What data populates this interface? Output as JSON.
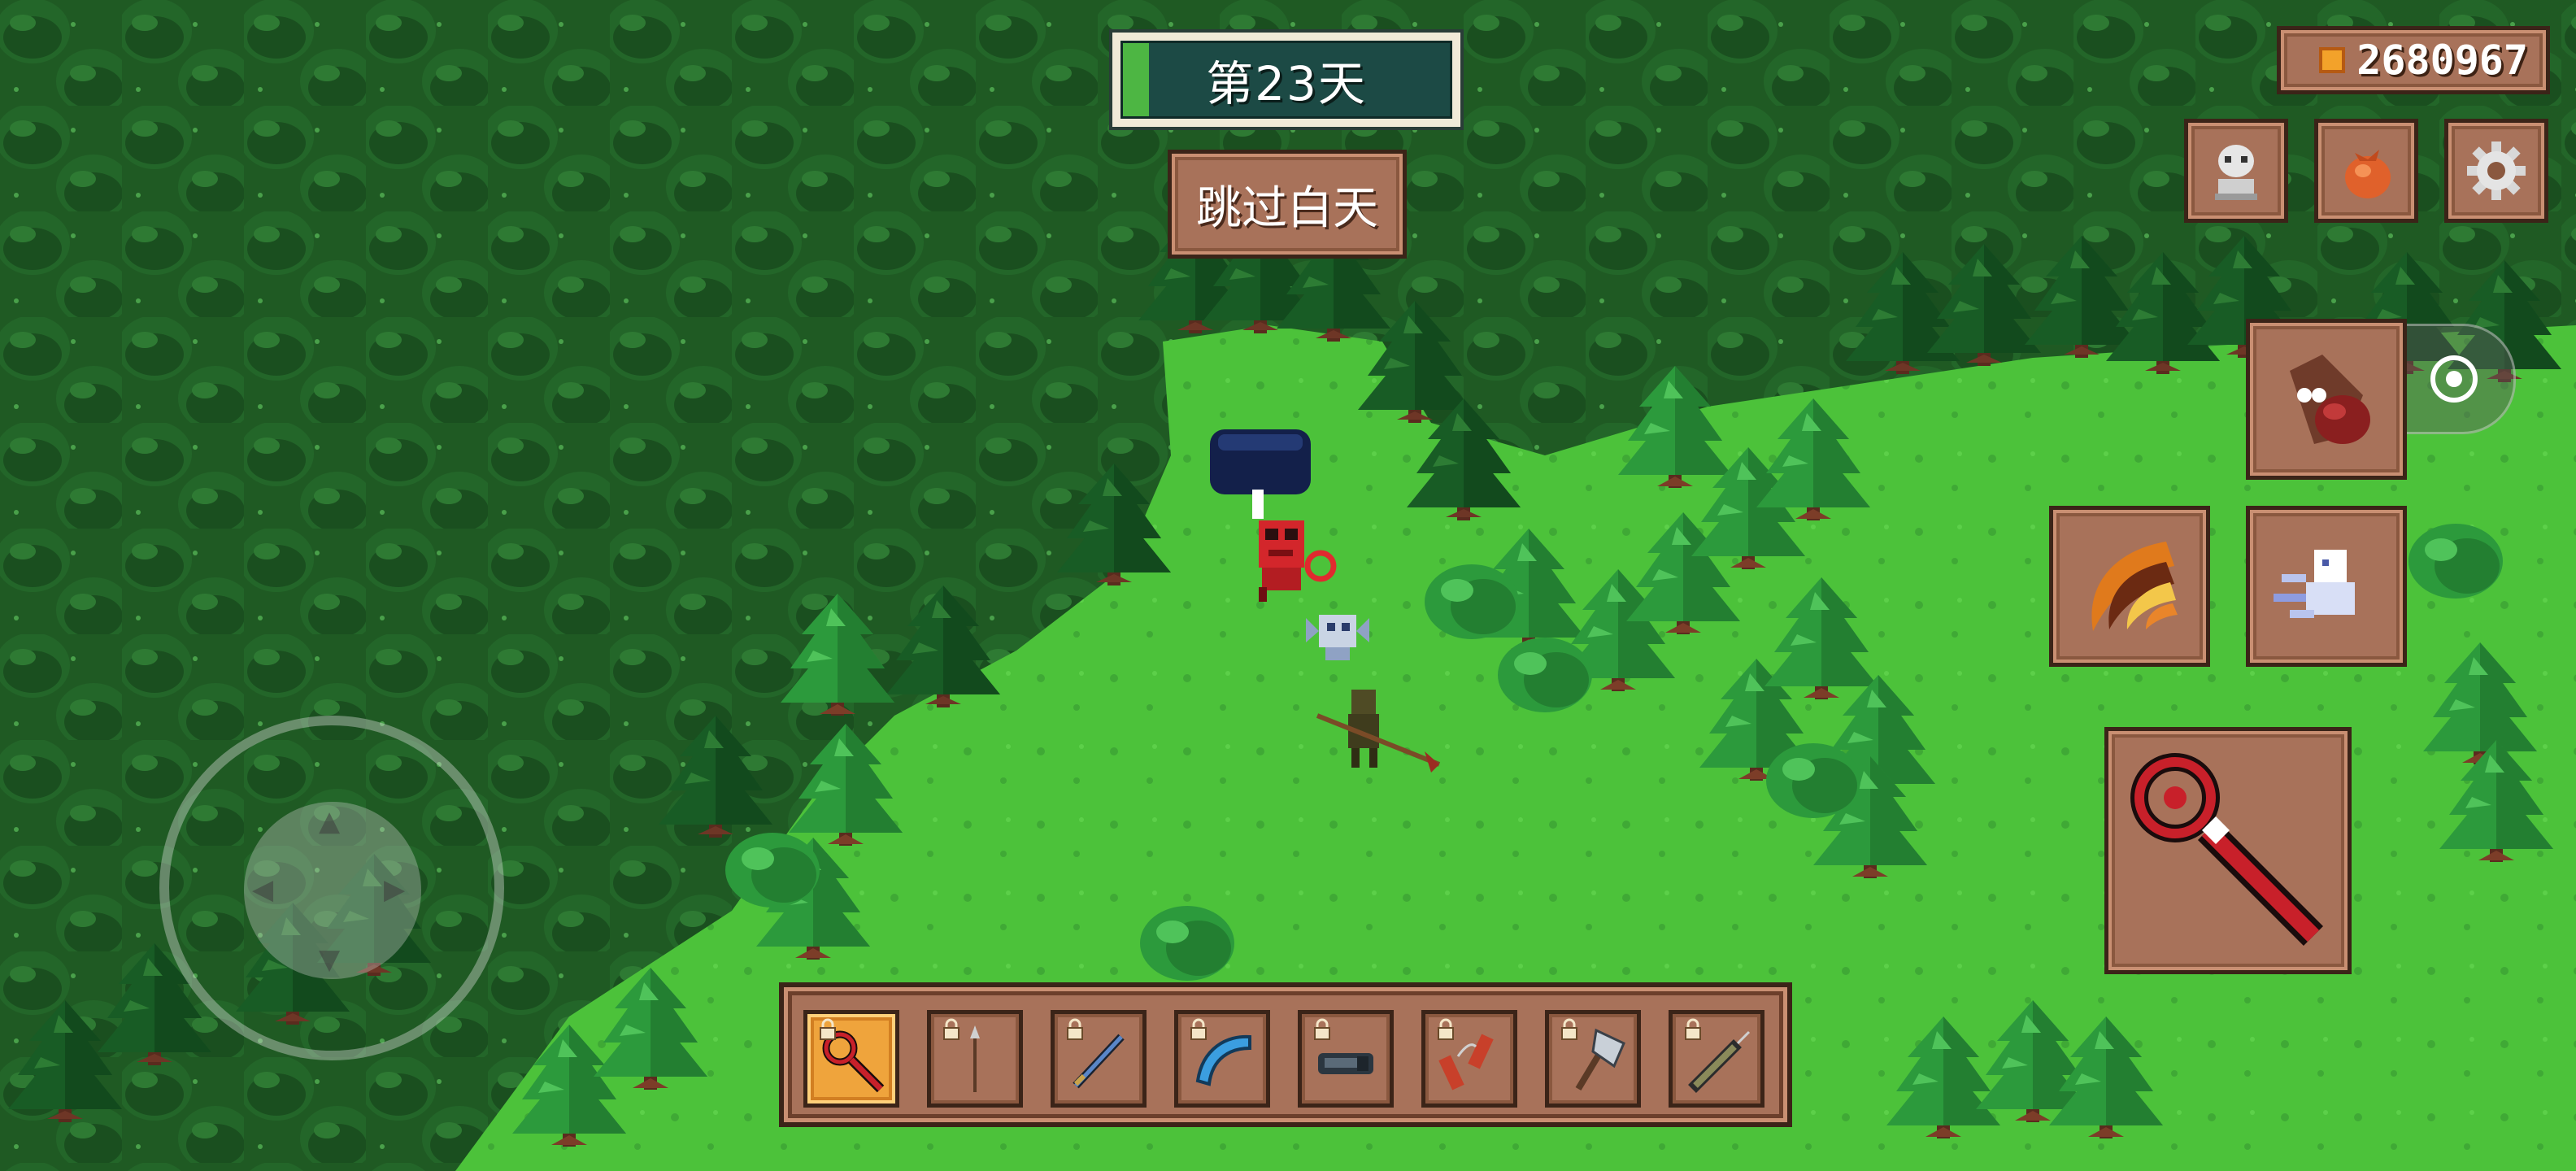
{
  "hud": {
    "day_label": "第23天",
    "day_progress": 0.08,
    "skip_day_label": "跳过白天",
    "coins": "2680967"
  },
  "top_right_buttons": [
    {
      "name": "character-icon"
    },
    {
      "name": "bag-icon"
    },
    {
      "name": "settings-gear-icon"
    }
  ],
  "skills": [
    {
      "name": "potion-skill-icon"
    },
    {
      "name": "fire-slash-skill-icon"
    },
    {
      "name": "ghost-dash-skill-icon"
    }
  ],
  "main_weapon": {
    "name": "red-scepter-icon"
  },
  "hotbar": {
    "selected_index": 0,
    "slots": [
      {
        "name": "red-scepter-icon",
        "locked": true
      },
      {
        "name": "spear-icon",
        "locked": true
      },
      {
        "name": "blue-sword-icon",
        "locked": true
      },
      {
        "name": "boomerang-icon",
        "locked": true
      },
      {
        "name": "gauntlet-icon",
        "locked": true
      },
      {
        "name": "nunchaku-icon",
        "locked": true
      },
      {
        "name": "axe-icon",
        "locked": true
      },
      {
        "name": "syringe-icon",
        "locked": true
      }
    ]
  },
  "colors": {
    "grass": "#4cc23a",
    "forest_dark": "#1f5a23",
    "wood": "#a8725a",
    "wood_border": "#3b2418",
    "day_fill": "#4db643"
  }
}
